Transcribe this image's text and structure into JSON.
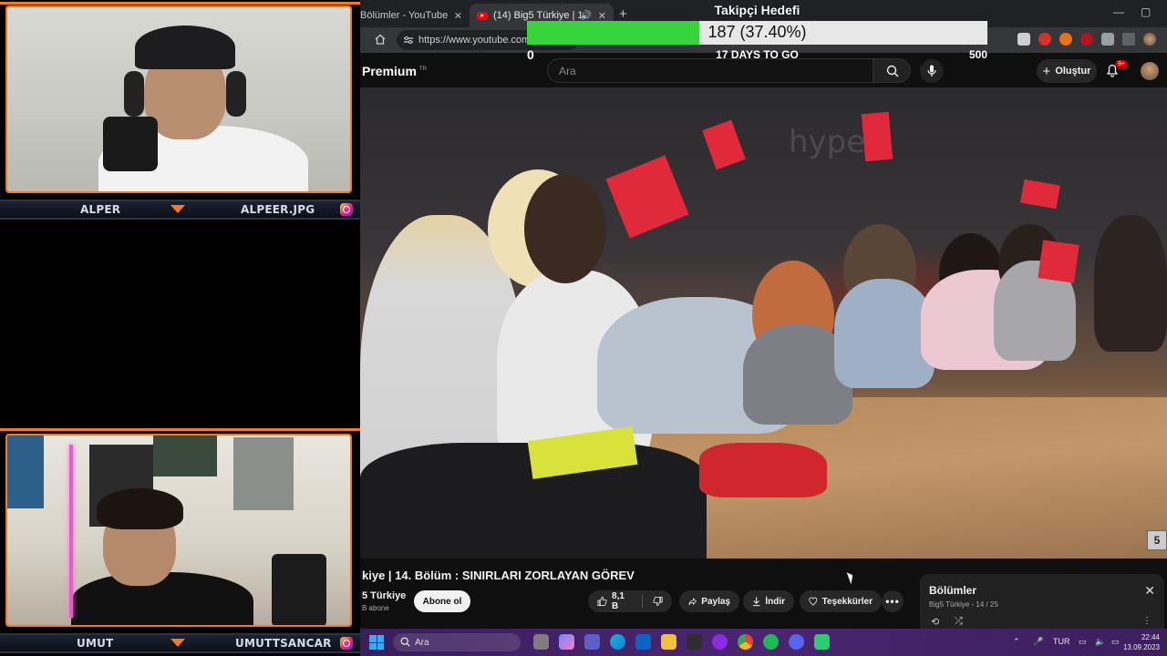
{
  "stream": {
    "top_cam": {
      "left_label": "ALPER",
      "right_label": "ALPEER.JPG"
    },
    "bottom_cam": {
      "left_label": "UMUT",
      "right_label": "UMUTTSANCAR"
    },
    "accent_color": "#f47a20"
  },
  "goal": {
    "title": "Takipçi Hedefi",
    "current_label": "187 (37.40%)",
    "progress_fraction": 0.374,
    "min": "0",
    "max": "500",
    "days_left": "17 DAYS TO GO",
    "fill_color": "#37d43b"
  },
  "browser": {
    "tabs": [
      {
        "label": "Bölümler - YouTube"
      },
      {
        "label": "(14) Big5 Türkiye | 14. Bölüm"
      }
    ],
    "url": "https://www.youtube.com/w"
  },
  "youtube": {
    "brand": "Premium",
    "brand_region": "TR",
    "search_placeholder": "Ara",
    "create_label": "Oluştur",
    "notif_count": "9+",
    "video_title": "kiye | 14. Bölüm : SINIRLARI ZORLAYAN GÖREV",
    "channel_name": "5 Türkiye",
    "channel_subs": "B abone",
    "subscribe_label": "Abone ol",
    "likes": "8,1 B",
    "share_label": "Paylaş",
    "download_label": "İndir",
    "thanks_label": "Teşekkürler",
    "side_tab": "5",
    "video_text": "hyper",
    "playlist": {
      "title": "Bölümler",
      "subtitle": "Big5 Türkiye - 14 / 25"
    }
  },
  "taskbar": {
    "search_placeholder": "Ara",
    "language": "TUR",
    "time": "22:44",
    "date": "13.09.2023"
  }
}
